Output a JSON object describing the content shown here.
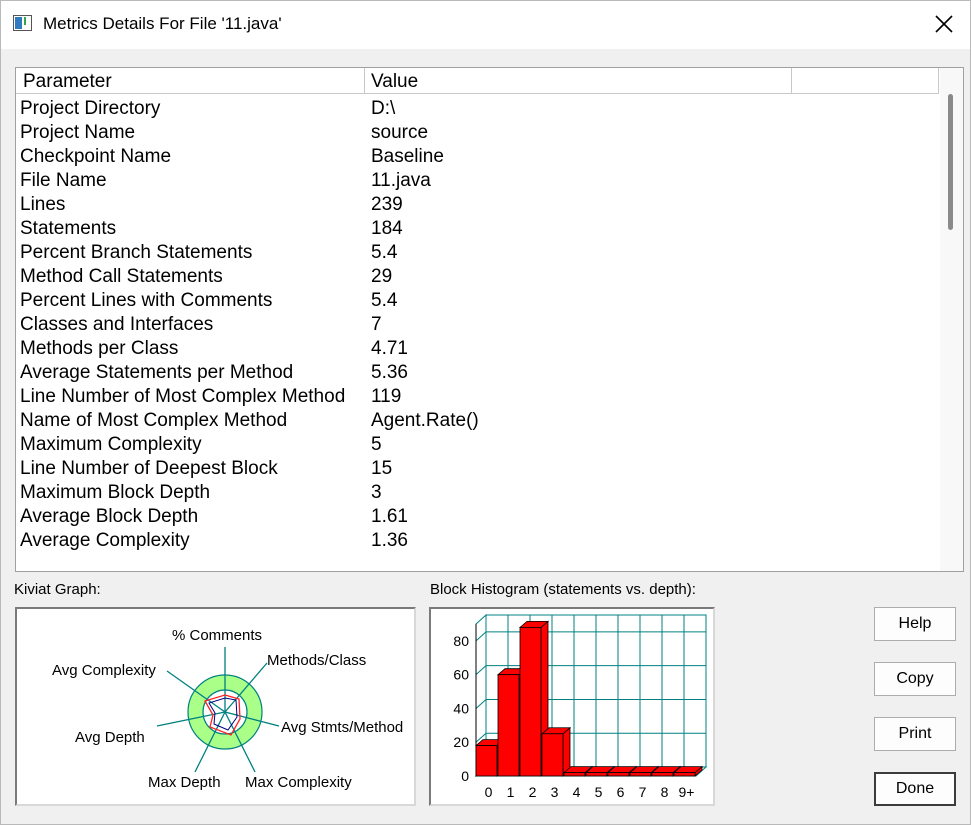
{
  "window": {
    "title": "Metrics Details For File '11.java'"
  },
  "table": {
    "columns": [
      "Parameter",
      "Value",
      ""
    ],
    "rows": [
      {
        "parameter": "Project Directory",
        "value": "D:\\"
      },
      {
        "parameter": "Project Name",
        "value": "source"
      },
      {
        "parameter": "Checkpoint Name",
        "value": "Baseline"
      },
      {
        "parameter": "File Name",
        "value": "11.java"
      },
      {
        "parameter": "Lines",
        "value": "239"
      },
      {
        "parameter": "Statements",
        "value": "184"
      },
      {
        "parameter": "Percent Branch Statements",
        "value": "5.4"
      },
      {
        "parameter": "Method Call Statements",
        "value": "29"
      },
      {
        "parameter": "Percent Lines with Comments",
        "value": "5.4"
      },
      {
        "parameter": "Classes and Interfaces",
        "value": "7"
      },
      {
        "parameter": "Methods per Class",
        "value": "4.71"
      },
      {
        "parameter": "Average Statements per Method",
        "value": "5.36"
      },
      {
        "parameter": "Line Number of Most Complex Method",
        "value": "119"
      },
      {
        "parameter": "Name of Most Complex Method",
        "value": "Agent.Rate()"
      },
      {
        "parameter": "Maximum Complexity",
        "value": "5"
      },
      {
        "parameter": "Line Number of Deepest Block",
        "value": "15"
      },
      {
        "parameter": "Maximum Block Depth",
        "value": "3"
      },
      {
        "parameter": "Average Block Depth",
        "value": "1.61"
      },
      {
        "parameter": "Average Complexity",
        "value": "1.36"
      }
    ]
  },
  "kiviat": {
    "label": "Kiviat Graph:",
    "axes": [
      "% Comments",
      "Methods/Class",
      "Avg Stmts/Method",
      "Max Complexity",
      "Max Depth",
      "Avg Depth",
      "Avg Complexity"
    ]
  },
  "histogram": {
    "label": "Block Histogram (statements vs. depth):",
    "colors": {
      "bar": "#ff0000",
      "grid": "#008080"
    }
  },
  "buttons": {
    "help": "Help",
    "copy": "Copy",
    "print": "Print",
    "done": "Done"
  },
  "chart_data": {
    "type": "bar",
    "categories": [
      "0",
      "1",
      "2",
      "3",
      "4",
      "5",
      "6",
      "7",
      "8",
      "9+"
    ],
    "values": [
      18,
      60,
      88,
      25,
      2,
      2,
      2,
      2,
      2,
      2
    ],
    "ylim": [
      0,
      90
    ],
    "yticks": [
      0,
      20,
      40,
      60,
      80
    ],
    "grid": true
  }
}
